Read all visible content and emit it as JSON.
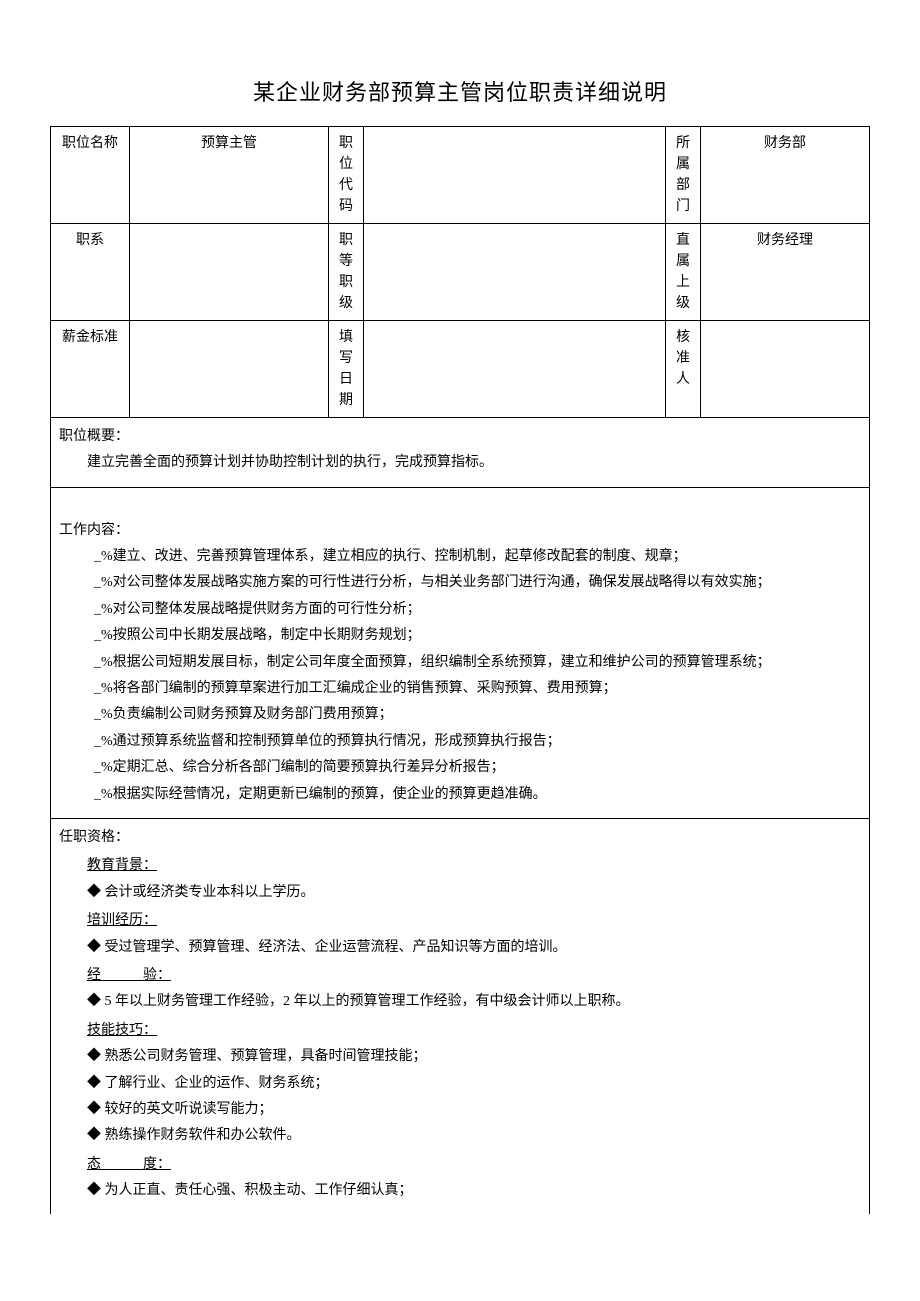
{
  "title": "某企业财务部预算主管岗位职责详细说明",
  "info": {
    "row1": {
      "label": "职位名称",
      "value": "预算主管",
      "mid_label": "职位代码",
      "mid_value": "",
      "right_label": "所属部门",
      "right_value": "财务部"
    },
    "row2": {
      "label": "职系",
      "value": "",
      "mid_label": "职等职级",
      "mid_value": "",
      "right_label": "直属上级",
      "right_value": "财务经理"
    },
    "row3": {
      "label": "薪金标准",
      "value": "",
      "mid_label": "填写日期",
      "mid_value": "",
      "right_label": "核准人",
      "right_value": ""
    }
  },
  "summary": {
    "header": "职位概要：",
    "text": "建立完善全面的预算计划并协助控制计划的执行，完成预算指标。"
  },
  "work": {
    "header": "工作内容：",
    "items": [
      "_%建立、改进、完善预算管理体系，建立相应的执行、控制机制，起草修改配套的制度、规章；",
      "_%对公司整体发展战略实施方案的可行性进行分析，与相关业务部门进行沟通，确保发展战略得以有效实施；",
      "_%对公司整体发展战略提供财务方面的可行性分析；",
      "_%按照公司中长期发展战略，制定中长期财务规划；",
      "_%根据公司短期发展目标，制定公司年度全面预算，组织编制全系统预算，建立和维护公司的预算管理系统；",
      "_%将各部门编制的预算草案进行加工汇编成企业的销售预算、采购预算、费用预算；",
      "_%负责编制公司财务预算及财务部门费用预算；",
      "_%通过预算系统监督和控制预算单位的预算执行情况，形成预算执行报告；",
      "_%定期汇总、综合分析各部门编制的简要预算执行差异分析报告；",
      "_%根据实际经营情况，定期更新已编制的预算，使企业的预算更趋准确。"
    ]
  },
  "qual": {
    "header": "任职资格：",
    "edu_head": "教育背景：",
    "edu_items": [
      "会计或经济类专业本科以上学历。"
    ],
    "train_head": "培训经历：",
    "train_items": [
      "受过管理学、预算管理、经济法、企业运营流程、产品知识等方面的培训。"
    ],
    "exp_head_a": "经",
    "exp_head_b": "验：",
    "exp_items": [
      "5 年以上财务管理工作经验，2 年以上的预算管理工作经验，有中级会计师以上职称。"
    ],
    "skill_head": "技能技巧：",
    "skill_items": [
      "熟悉公司财务管理、预算管理，具备时间管理技能；",
      "了解行业、企业的运作、财务系统；",
      "较好的英文听说读写能力；",
      "熟练操作财务软件和办公软件。"
    ],
    "att_head_a": "态",
    "att_head_b": "度：",
    "att_items": [
      "为人正直、责任心强、积极主动、工作仔细认真；"
    ]
  }
}
